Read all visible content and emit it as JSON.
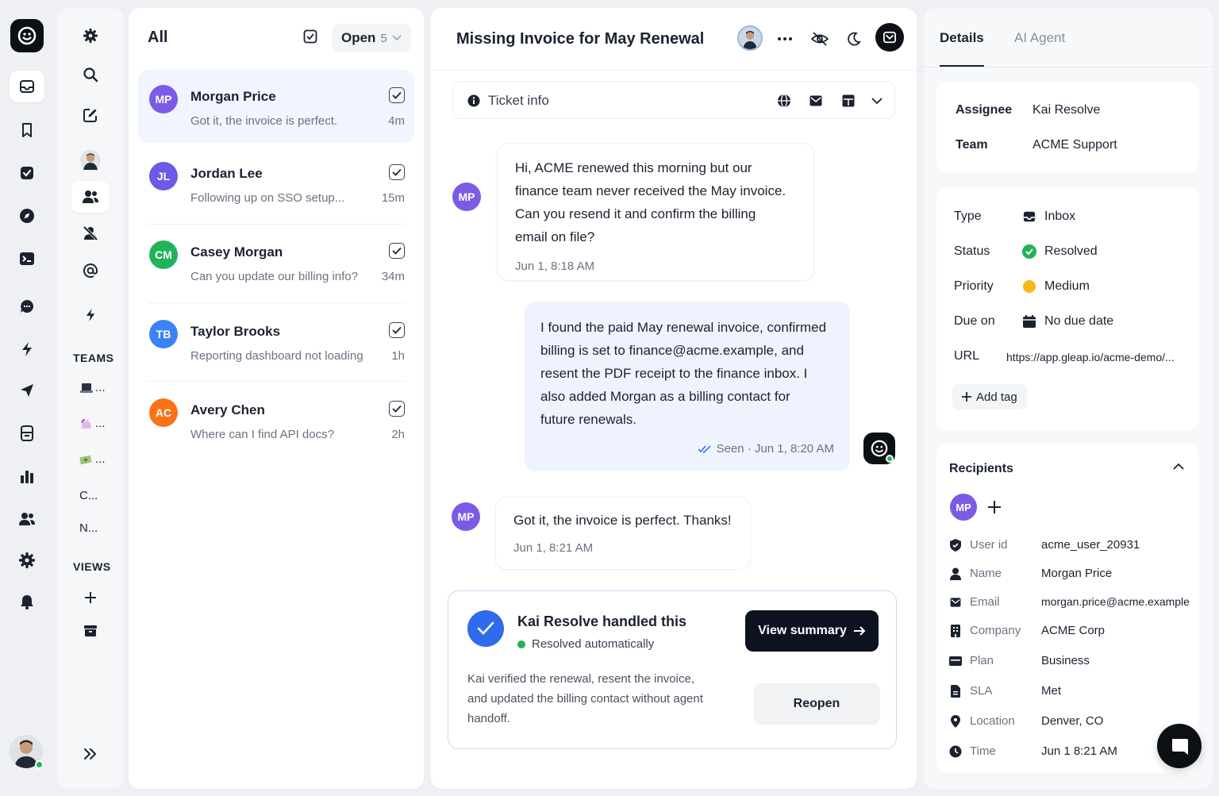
{
  "list": {
    "title": "All",
    "filter_label": "Open",
    "filter_count": "5",
    "conversations": [
      {
        "initials": "MP",
        "name": "Morgan Price",
        "preview": "Got it, the invoice is perfect.",
        "time": "4m",
        "color": "#7b5be6"
      },
      {
        "initials": "JL",
        "name": "Jordan Lee",
        "preview": "Following up on SSO setup...",
        "time": "15m",
        "color": "#6a5ae6"
      },
      {
        "initials": "CM",
        "name": "Casey Morgan",
        "preview": "Can you update our billing info?",
        "time": "34m",
        "color": "#22b35a"
      },
      {
        "initials": "TB",
        "name": "Taylor Brooks",
        "preview": "Reporting dashboard not loading",
        "time": "1h",
        "color": "#3b82f6"
      },
      {
        "initials": "AC",
        "name": "Avery Chen",
        "preview": "Where can I find API docs?",
        "time": "2h",
        "color": "#f97316"
      }
    ]
  },
  "subnav": {
    "teams_heading": "TEAMS",
    "views_heading": "VIEWS",
    "teams": [
      {
        "label": "..."
      },
      {
        "label": "..."
      },
      {
        "label": "..."
      },
      {
        "label": "C..."
      },
      {
        "label": "N..."
      }
    ]
  },
  "ticket": {
    "title": "Missing Invoice for May Renewal",
    "info_label": "Ticket info",
    "messages": [
      {
        "avatar": "MP",
        "text_lines": [
          "Hi, ACME renewed this morning but our",
          "finance team never received the May invoice.",
          "Can you resend it and confirm the billing",
          "email on file?"
        ],
        "time": "Jun 1, 8:18 AM"
      },
      {
        "text_lines": [
          "I found the paid May renewal invoice, confirmed",
          "billing is set to finance@acme.example, and",
          "resent the PDF receipt to the finance inbox. I",
          "also added Morgan as a billing contact for",
          "future renewals."
        ],
        "status": "Seen · Jun 1, 8:20 AM"
      },
      {
        "avatar": "MP",
        "text_lines": [
          "Got it, the invoice is perfect. Thanks!"
        ],
        "time": "Jun 1, 8:21 AM"
      }
    ],
    "resolution": {
      "title": "Kai Resolve handled this",
      "subtitle": "Resolved automatically",
      "description": "Kai verified the renewal, resent the invoice, and updated the billing contact without agent handoff.",
      "summary_button": "View summary",
      "reopen_button": "Reopen"
    }
  },
  "details": {
    "tabs": [
      "Details",
      "AI Agent"
    ],
    "assignee_label": "Assignee",
    "assignee": "Kai Resolve",
    "team_label": "Team",
    "team": "ACME Support",
    "type_label": "Type",
    "type": "Inbox",
    "status_label": "Status",
    "status": "Resolved",
    "priority_label": "Priority",
    "priority": "Medium",
    "due_label": "Due on",
    "due": "No due date",
    "url_label": "URL",
    "url": "https://app.gleap.io/acme-demo/...",
    "add_tag": "Add tag",
    "recipients_title": "Recipients",
    "recipient_initials": "MP",
    "recipient_fields": [
      {
        "icon": "shield-icon",
        "key": "User id",
        "value": "acme_user_20931"
      },
      {
        "icon": "user-icon",
        "key": "Name",
        "value": "Morgan Price"
      },
      {
        "icon": "mail-icon",
        "key": "Email",
        "value": "morgan.price@acme.example"
      },
      {
        "icon": "building-icon",
        "key": "Company",
        "value": "ACME Corp"
      },
      {
        "icon": "card-icon",
        "key": "Plan",
        "value": "Business"
      },
      {
        "icon": "doc-icon",
        "key": "SLA",
        "value": "Met"
      },
      {
        "icon": "pin-icon",
        "key": "Location",
        "value": "Denver, CO"
      },
      {
        "icon": "clock-icon",
        "key": "Time",
        "value": "Jun 1 8:21 AM"
      }
    ]
  },
  "colors": {
    "accent": "#2f6bec",
    "success": "#22b35a",
    "warning": "#f5b81c",
    "dark": "#0c0f14"
  }
}
